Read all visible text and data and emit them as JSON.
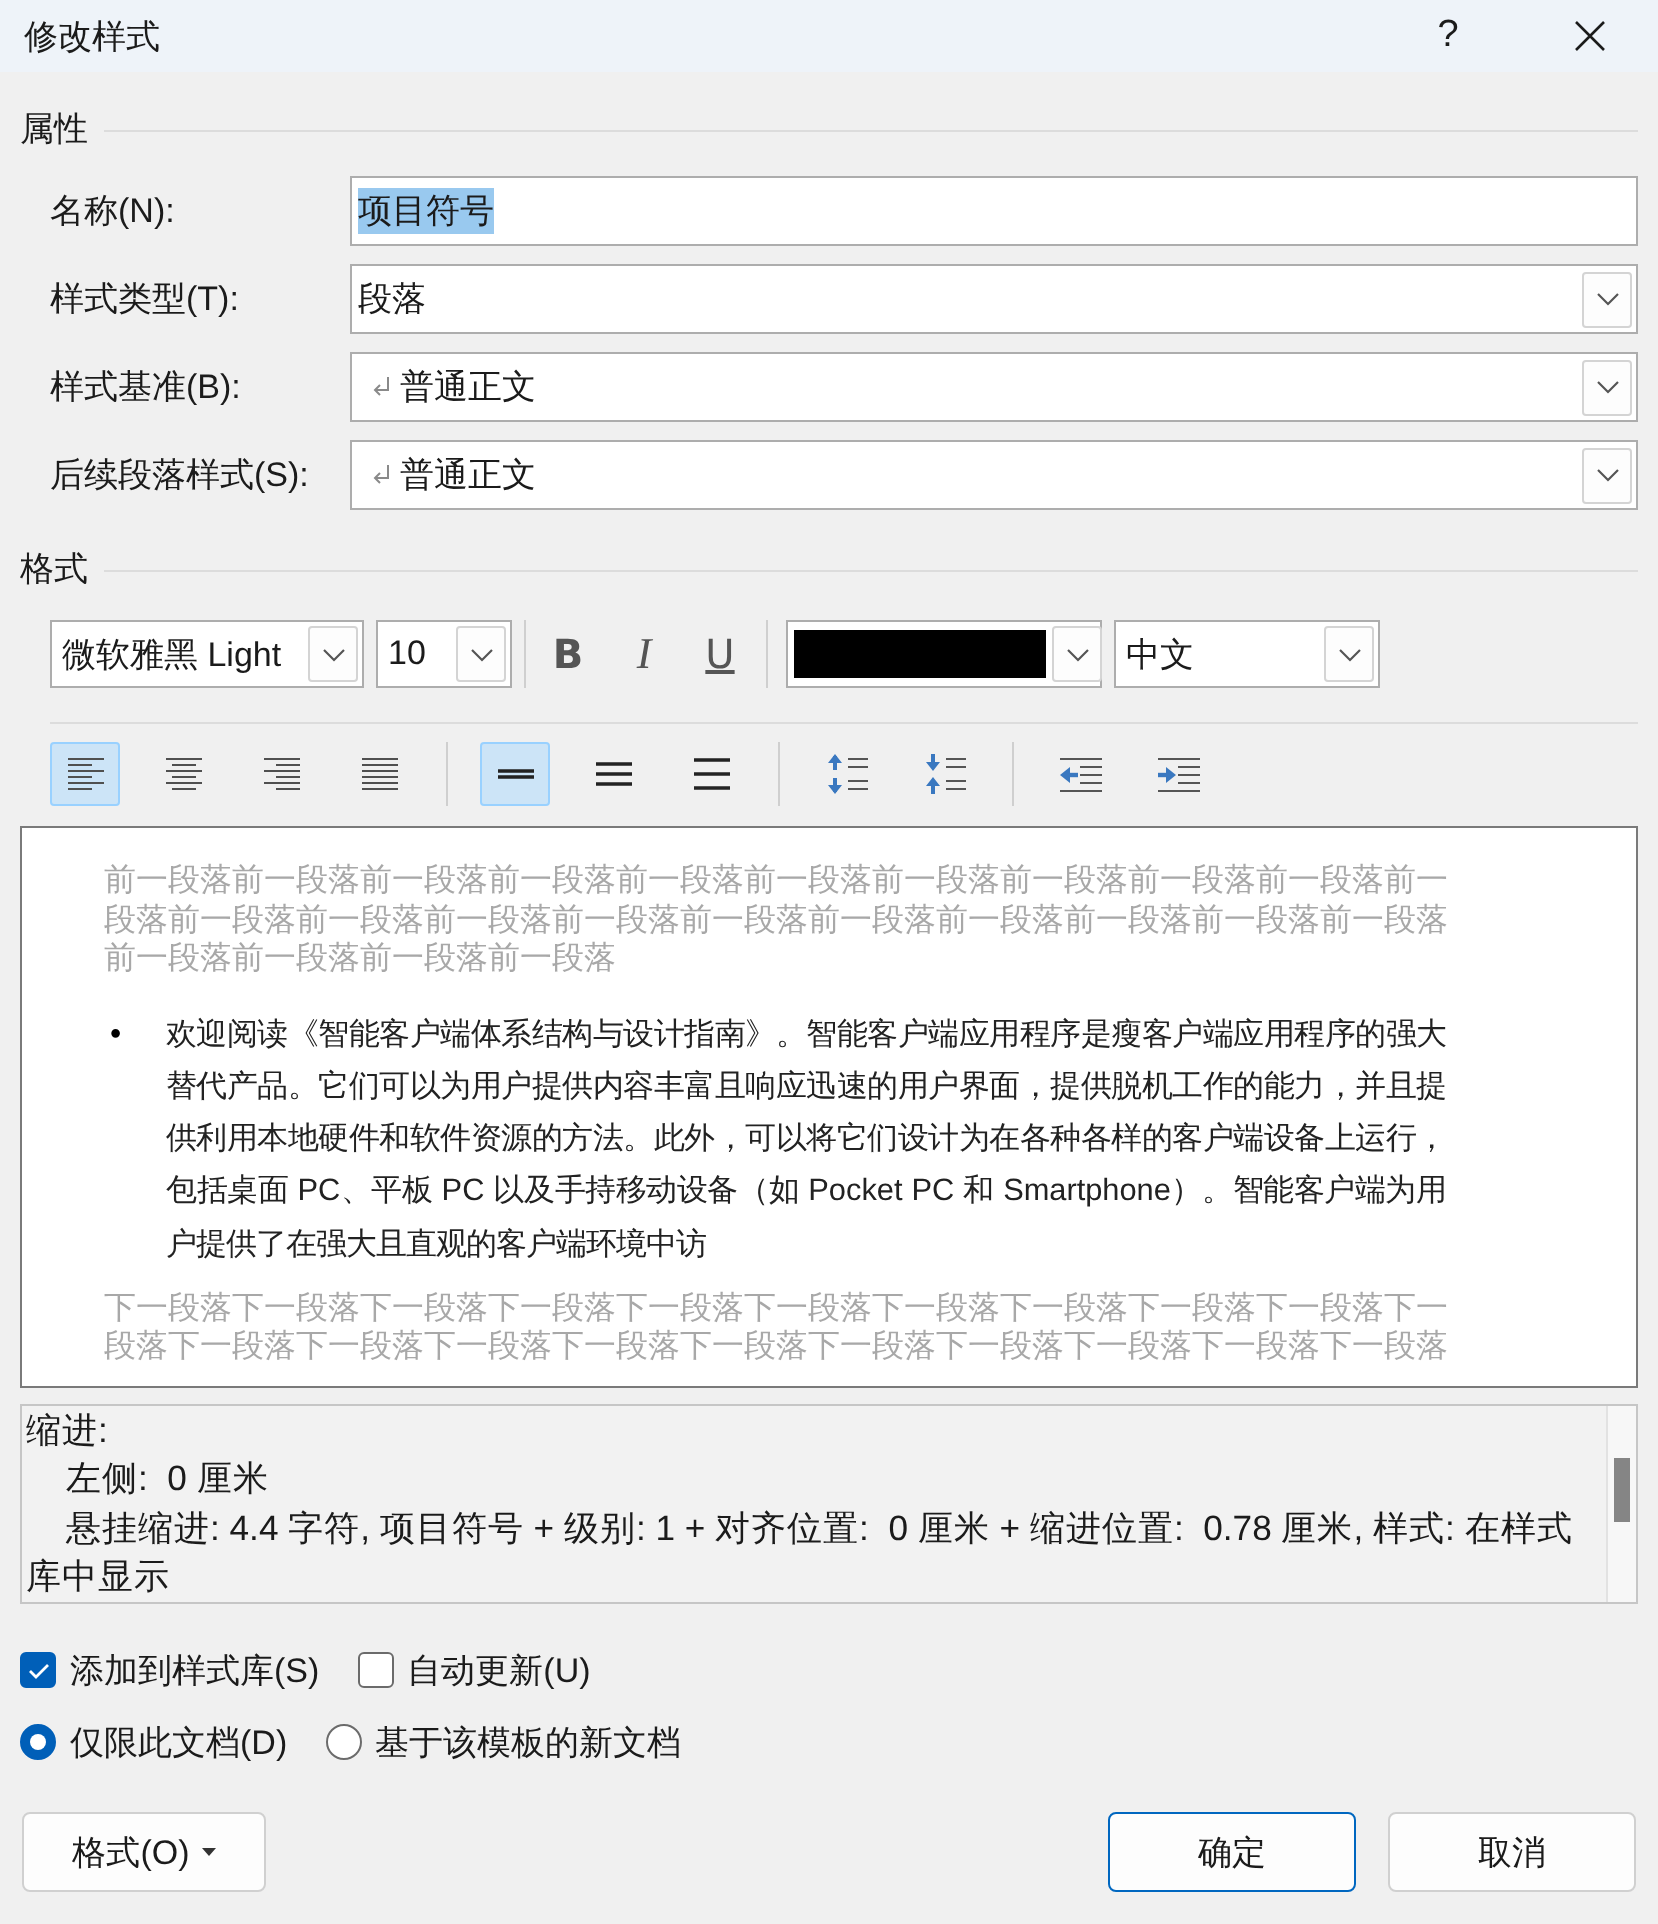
{
  "window": {
    "title": "修改样式",
    "help": "?"
  },
  "properties": {
    "heading": "属性",
    "fields": [
      {
        "kind": "text",
        "label": "名称(N):",
        "value": "项目符号",
        "value_selected": true
      },
      {
        "kind": "combo",
        "label": "样式类型(T):",
        "value": "段落",
        "paragraph_mark": false
      },
      {
        "kind": "combo",
        "label": "样式基准(B):",
        "value": "普通正文",
        "paragraph_mark": true
      },
      {
        "kind": "combo",
        "label": "后续段落样式(S):",
        "value": "普通正文",
        "paragraph_mark": true
      }
    ]
  },
  "formatting": {
    "heading": "格式",
    "font": {
      "value": "微软雅黑 Light"
    },
    "size": {
      "value": "10"
    },
    "styles": [
      {
        "kind": "bold",
        "label": "B",
        "on": false
      },
      {
        "kind": "italic",
        "label": "I",
        "on": false
      },
      {
        "kind": "underline",
        "label": "U",
        "on": false
      }
    ],
    "font_color": {
      "color": "#000000"
    },
    "language": {
      "value": "中文"
    },
    "alignment": [
      {
        "kind": "left",
        "selected": true
      },
      {
        "kind": "center",
        "selected": false
      },
      {
        "kind": "right",
        "selected": false
      },
      {
        "kind": "justify",
        "selected": false
      }
    ],
    "line_spacing": [
      {
        "kind": "single",
        "selected": true
      },
      {
        "kind": "one_half",
        "selected": false
      },
      {
        "kind": "double",
        "selected": false
      }
    ],
    "paragraph_spacing": [
      {
        "kind": "increase"
      },
      {
        "kind": "decrease"
      }
    ],
    "indent": [
      {
        "kind": "decrease"
      },
      {
        "kind": "increase"
      }
    ]
  },
  "preview": {
    "previous_paragraph": "前一段落前一段落前一段落前一段落前一段落前一段落前一段落前一段落前一段落前一段落前一段落前一段落前一段落前一段落前一段落前一段落前一段落前一段落前一段落前一段落前一段落前一段落前一段落前一段落前一段落",
    "bullet": "•",
    "paragraph": "欢迎阅读《智能客户端体系结构与设计指南》。智能客户端应用程序是瘦客户端应用程序的强大替代产品。它们可以为用户提供内容丰富且响应迅速的用户界面，提供脱机工作的能力，并且提供利用本地硬件和软件资源的方法。此外，可以将它们设计为在各种各样的客户端设备上运行，包括桌面 PC、平板 PC 以及手持移动设备（如 Pocket PC 和 Smartphone）。智能客户端为用户提供了在强大且直观的客户端环境中访",
    "next_paragraph": "下一段落下一段落下一段落下一段落下一段落下一段落下一段落下一段落下一段落下一段落下一段落下一段落下一段落下一段落下一段落下一段落下一段落下一段落下一段落下一段落下一段落"
  },
  "description": {
    "heading": "缩进:",
    "lines": [
      "左侧:  0 厘米",
      "悬挂缩进: 4.4 字符, 项目符号 + 级别: 1 + 对齐位置:  0 厘米 + 缩进位置:  0.78 厘米, 样式: 在样式库中显示"
    ]
  },
  "options": {
    "checkboxes": [
      {
        "label": "添加到样式库(S)",
        "checked": true
      },
      {
        "label": "自动更新(U)",
        "checked": false
      }
    ],
    "radios": [
      {
        "label": "仅限此文档(D)",
        "selected": true
      },
      {
        "label": "基于该模板的新文档",
        "selected": false
      }
    ]
  },
  "buttons": [
    {
      "kind": "menu",
      "label": "格式(O)"
    },
    {
      "kind": "default",
      "label": "确定"
    },
    {
      "kind": "normal",
      "label": "取消"
    }
  ]
}
